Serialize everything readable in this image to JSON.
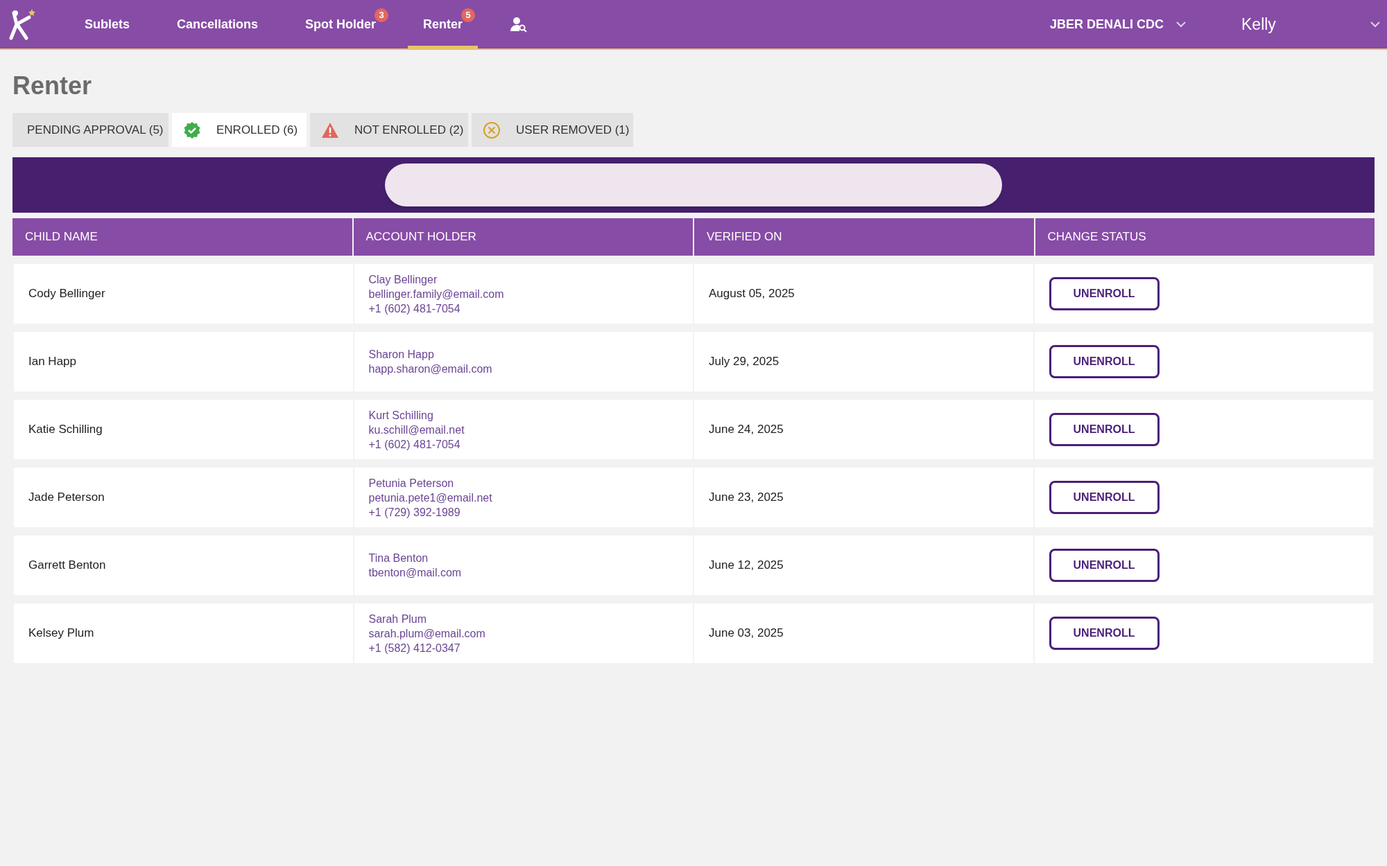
{
  "nav": {
    "items": [
      {
        "label": "Sublets",
        "selected": false
      },
      {
        "label": "Cancellations",
        "selected": false
      },
      {
        "label": "Spot Holder",
        "badge": "3",
        "selected": false
      },
      {
        "label": "Renter",
        "badge": "5",
        "selected": true
      }
    ],
    "location": "JBER DENALI CDC",
    "user": "Kelly"
  },
  "page_title": "Renter",
  "status_tabs": [
    {
      "label": "PENDING APPROVAL (5)",
      "kind": "none",
      "selected": false
    },
    {
      "label": "ENROLLED (6)",
      "kind": "check",
      "selected": true
    },
    {
      "label": "NOT ENROLLED (2)",
      "kind": "warning",
      "selected": false
    },
    {
      "label": "USER REMOVED (1)",
      "kind": "removed",
      "selected": false
    }
  ],
  "table": {
    "columns": [
      "CHILD NAME",
      "ACCOUNT HOLDER",
      "VERIFIED ON",
      "CHANGE STATUS"
    ],
    "rows": [
      {
        "child": "Cody Bellinger",
        "holder": [
          "Clay Bellinger",
          "bellinger.family@email.com",
          "+1 (602) 481-7054"
        ],
        "verified": "August 05, 2025",
        "action": "UNENROLL"
      },
      {
        "child": "Ian Happ",
        "holder": [
          "Sharon Happ",
          "happ.sharon@email.com"
        ],
        "verified": "July 29, 2025",
        "action": "UNENROLL"
      },
      {
        "child": "Katie Schilling",
        "holder": [
          "Kurt Schilling",
          "ku.schill@email.net",
          "+1 (602) 481-7054"
        ],
        "verified": "June 24, 2025",
        "action": "UNENROLL"
      },
      {
        "child": "Jade Peterson",
        "holder": [
          "Petunia Peterson",
          "petunia.pete1@email.net",
          "+1 (729) 392-1989"
        ],
        "verified": "June 23, 2025",
        "action": "UNENROLL"
      },
      {
        "child": "Garrett Benton",
        "holder": [
          "Tina Benton",
          "tbenton@mail.com"
        ],
        "verified": "June 12, 2025",
        "action": "UNENROLL"
      },
      {
        "child": "Kelsey Plum",
        "holder": [
          "Sarah Plum",
          "sarah.plum@email.com",
          "+1 (582) 412-0347"
        ],
        "verified": "June 03, 2025",
        "action": "UNENROLL"
      }
    ]
  }
}
